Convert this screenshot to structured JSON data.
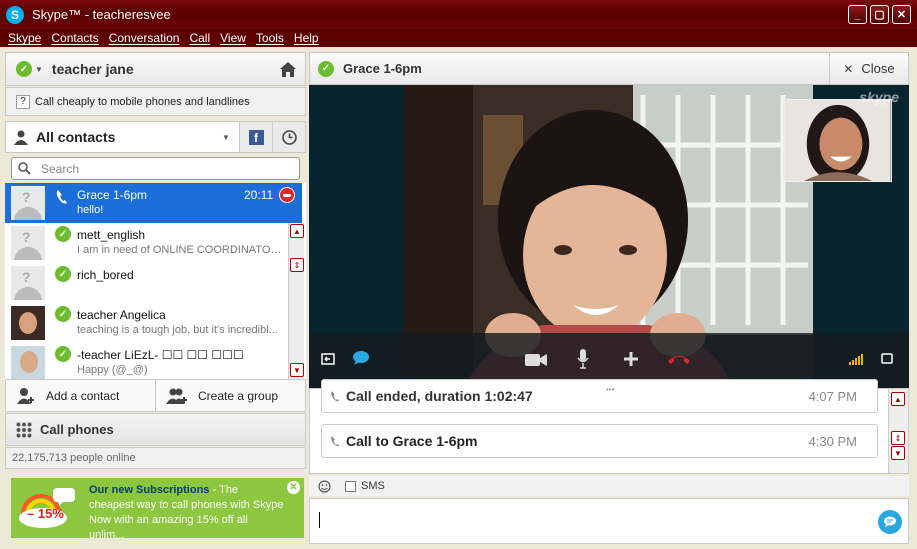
{
  "window": {
    "title": "Skype™ - teacheresvee",
    "min": "_",
    "max": "▢",
    "close": "✕"
  },
  "menu": [
    "Skype",
    "Contacts",
    "Conversation",
    "Call",
    "View",
    "Tools",
    "Help"
  ],
  "profile": {
    "name": "teacher jane",
    "home_icon": "home-icon"
  },
  "promo_line": "Call cheaply to mobile phones and landlines",
  "contacts_header": {
    "label": "All contacts",
    "facebook": "f"
  },
  "search": {
    "placeholder": "Search",
    "value": ""
  },
  "contacts": [
    {
      "name": "Grace 1-6pm",
      "status": "hello!",
      "time": "20:11",
      "selected": true
    },
    {
      "name": "mett_english",
      "status": "I am in need of ONLINE COORDINATOR..."
    },
    {
      "name": "rich_bored",
      "status": ""
    },
    {
      "name": "teacher Angelica",
      "status": "teaching is a tough job, but it's incredibl..."
    },
    {
      "name": "-teacher LiEzL- ☐☐ ☐☐ ☐☐☐",
      "status": "Happy (@_@)"
    }
  ],
  "actions": {
    "add_contact": "Add a contact",
    "create_group": "Create a group"
  },
  "call_phones": "Call phones",
  "online_count": "22,175,713 people online",
  "ad": {
    "title": "Our new Subscriptions",
    "text": " - The cheapest way to call phones with Skype Now with an amazing 15% off all unlim...",
    "badge": "– 15%"
  },
  "chat": {
    "title": "Grace 1-6pm",
    "close_label": "Close"
  },
  "watermark": "skype",
  "messages": [
    {
      "text": "Call ended, duration 1:02:47",
      "time": "4:07 PM"
    },
    {
      "text": "Call to Grace 1-6pm",
      "time": "4:30 PM"
    }
  ],
  "sms_label": "SMS",
  "colors": {
    "accent": "#00aff0",
    "frame": "#5e0000",
    "online": "#6bbd2f",
    "selected": "#1c6fd8",
    "end_call": "#e0262b"
  }
}
